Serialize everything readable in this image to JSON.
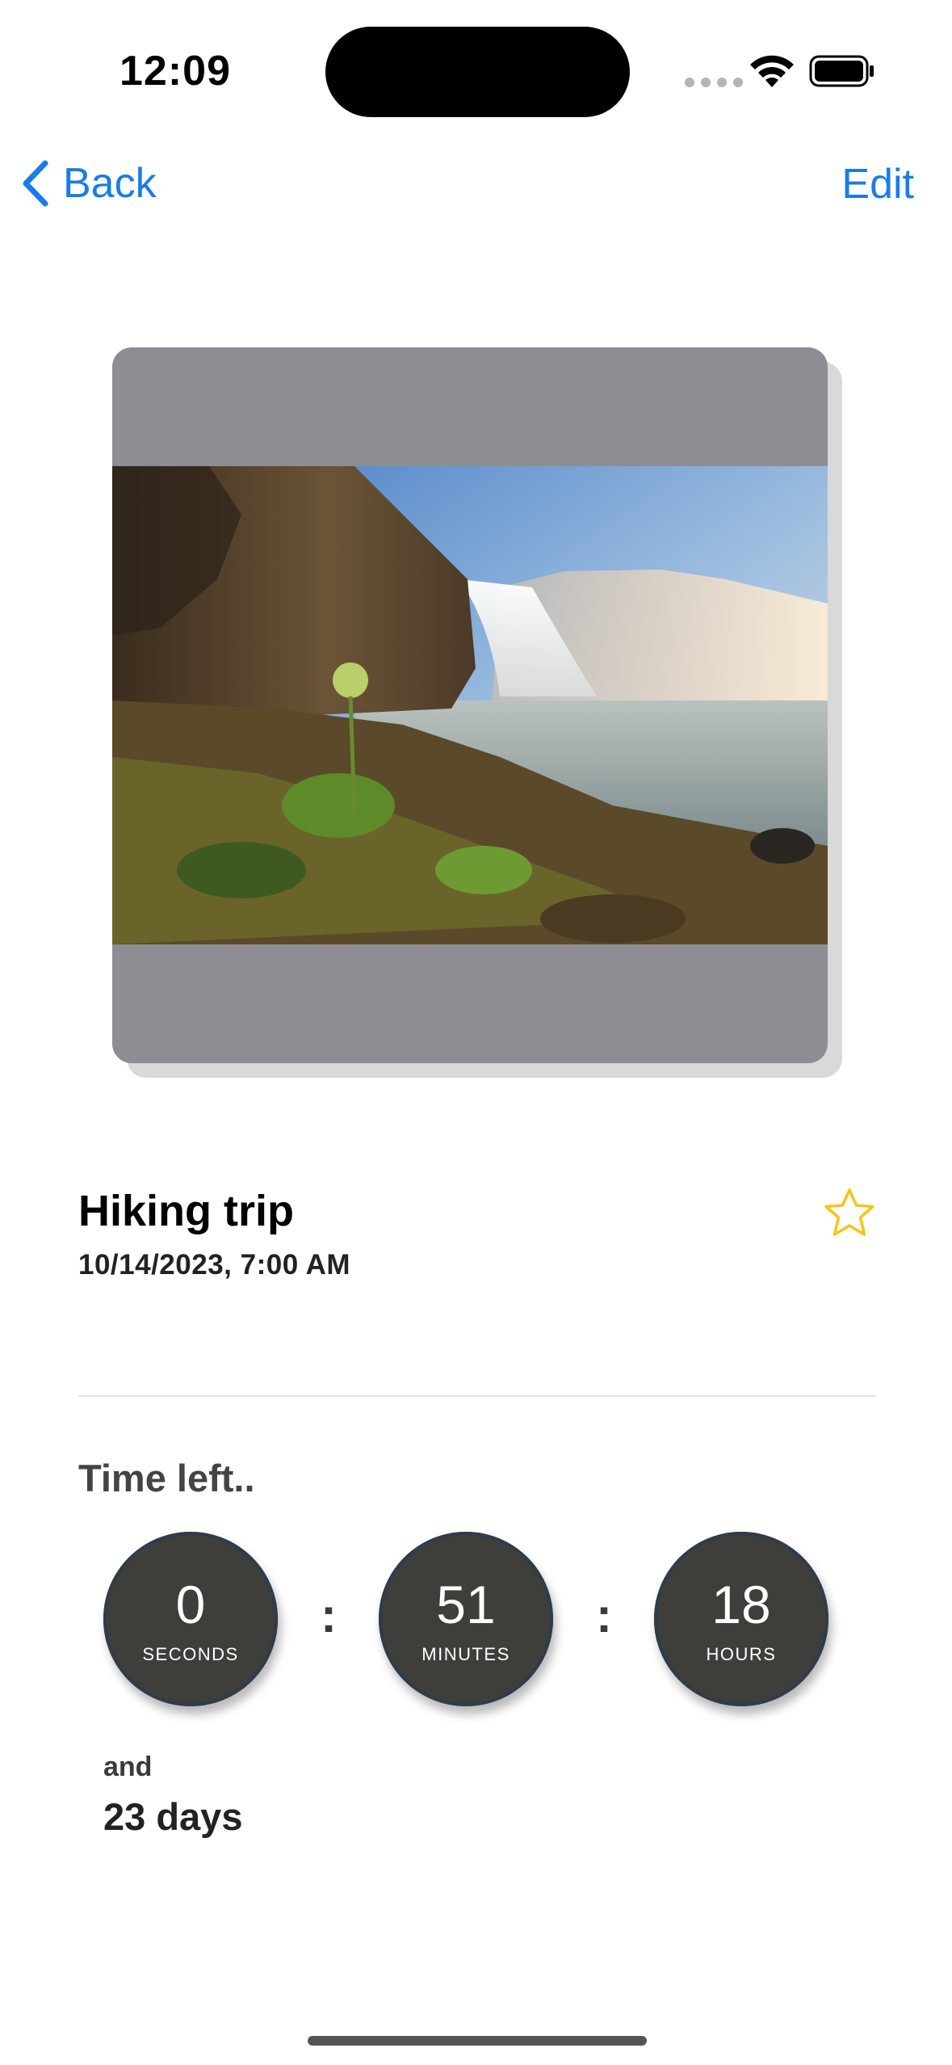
{
  "status_bar": {
    "time": "12:09"
  },
  "nav": {
    "back_label": "Back",
    "edit_label": "Edit"
  },
  "event": {
    "title": "Hiking trip",
    "date": "10/14/2023, 7:00 AM",
    "favorite_icon": "star-outline-icon"
  },
  "countdown": {
    "heading": "Time left..",
    "units": [
      {
        "value": "0",
        "label": "SECONDS"
      },
      {
        "value": "51",
        "label": "MINUTES"
      },
      {
        "value": "18",
        "label": "HOURS"
      }
    ],
    "separator": ":",
    "and_label": "and",
    "days_text": "23 days"
  },
  "colors": {
    "accent": "#1a7ce6",
    "circle_bg": "#3e3f3b",
    "card_bg": "#8d8d93",
    "star": "#f5c518"
  }
}
